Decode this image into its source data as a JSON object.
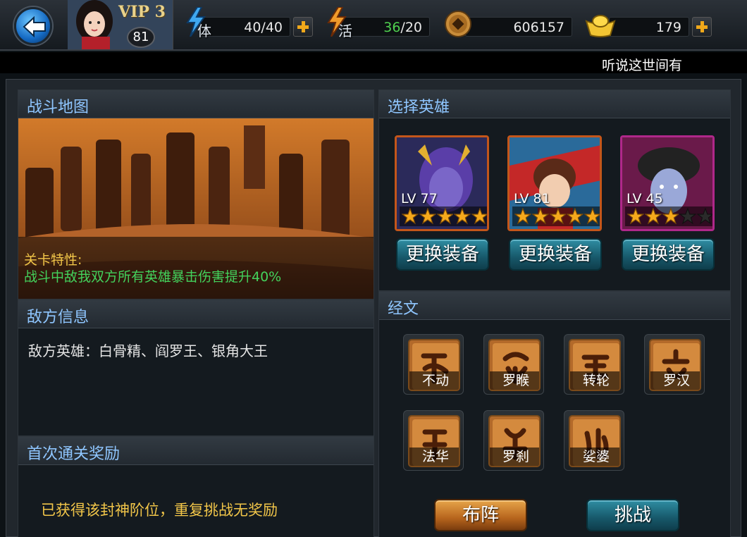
{
  "player": {
    "vip": "VIP 3",
    "level": "81"
  },
  "resources": {
    "stamina": {
      "label": "体",
      "current": "40",
      "max": "/40"
    },
    "vitality": {
      "label": "活",
      "current": "36",
      "max": "/20"
    },
    "coins": {
      "value": "606157"
    },
    "gold": {
      "value": "179"
    }
  },
  "ticker": "听说这世间有",
  "battle_map": {
    "title": "战斗地图",
    "stage_label": "关卡特性:",
    "stage_desc": "战斗中敌我双方所有英雄暴击伤害提升40%"
  },
  "enemy_info": {
    "title": "敌方信息",
    "text": "敌方英雄：白骨精、阎罗王、银角大王"
  },
  "first_reward": {
    "title": "首次通关奖励",
    "text": "已获得该封神阶位，重复挑战无奖励"
  },
  "hero_select": {
    "title": "选择英雄",
    "heroes": [
      {
        "level": "LV 77",
        "stars": 5,
        "button": "更换装备"
      },
      {
        "level": "LV 81",
        "stars": 5,
        "button": "更换装备"
      },
      {
        "level": "LV 45",
        "stars": 3,
        "button": "更换装备"
      }
    ]
  },
  "scriptures": {
    "title": "经文",
    "items": [
      "不动",
      "罗睺",
      "转轮",
      "罗汉",
      "法华",
      "罗刹",
      "娑婆"
    ]
  },
  "actions": {
    "formation": "布阵",
    "challenge": "挑战"
  }
}
